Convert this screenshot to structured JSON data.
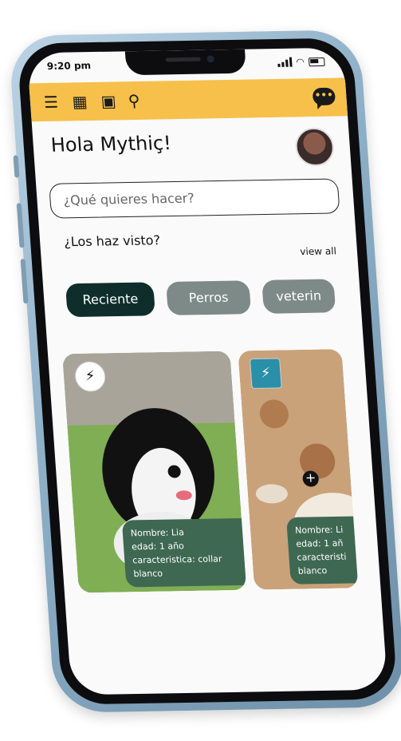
{
  "status": {
    "time": "9:20 pm"
  },
  "topbar": {
    "icons": [
      "menu-icon",
      "calendar-icon",
      "add-book-icon",
      "search-icon"
    ],
    "chat_icon": "chat-bubble-icon",
    "color": "#f6c04a"
  },
  "greeting": "Hola Mythiç!",
  "search": {
    "placeholder": "¿Qué quieres hacer?"
  },
  "section": {
    "title": "¿Los haz visto?",
    "view_all": "view all"
  },
  "chips": [
    {
      "label": "Reciente",
      "active": true
    },
    {
      "label": "Perros",
      "active": false
    },
    {
      "label": "veterin",
      "active": false
    }
  ],
  "cards": [
    {
      "name": "Nombre: Lia",
      "age": "edad: 1 año",
      "trait": "caracteristica: collar blanco"
    },
    {
      "name": "Nombre: Li",
      "age": "edad: 1 añ",
      "trait": "caracteristi blanco"
    }
  ],
  "colors": {
    "primary_dark": "#0f2e2b",
    "chip_inactive": "#7e8a88",
    "card_info": "#3e6852"
  }
}
